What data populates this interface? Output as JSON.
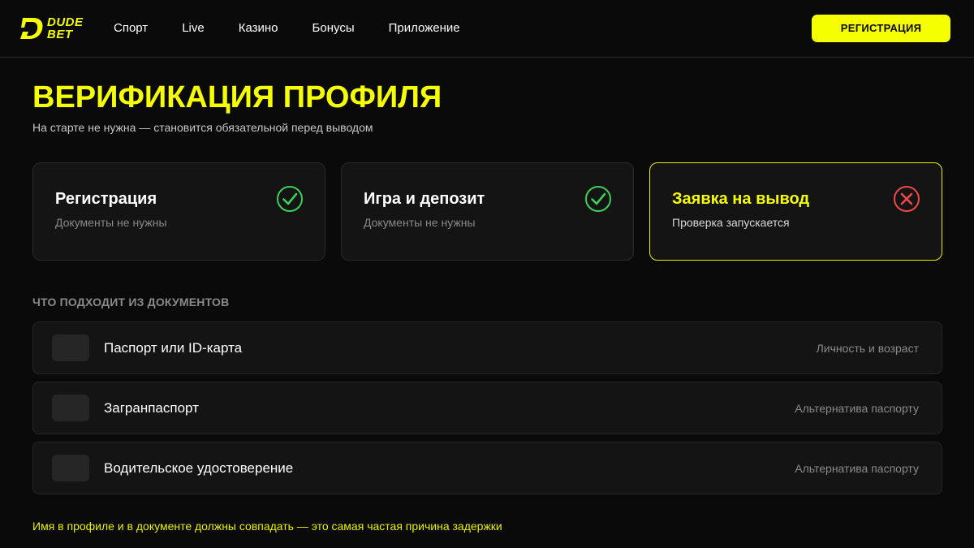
{
  "header": {
    "logo_line1": "DUDE",
    "logo_line2": "BET",
    "nav": [
      "Спорт",
      "Live",
      "Казино",
      "Бонусы",
      "Приложение"
    ],
    "register_label": "РЕГИСТРАЦИЯ"
  },
  "page": {
    "title": "ВЕРИФИКАЦИЯ ПРОФИЛЯ",
    "subtitle": "На старте не нужна — становится обязательной перед выводом"
  },
  "steps": [
    {
      "title": "Регистрация",
      "desc": "Документы не нужны",
      "status": "done",
      "icon": "check-circle-icon"
    },
    {
      "title": "Игра и депозит",
      "desc": "Документы не нужны",
      "status": "done",
      "icon": "check-circle-icon"
    },
    {
      "title": "Заявка на вывод",
      "desc": "Проверка запускается",
      "status": "required",
      "icon": "x-circle-icon"
    }
  ],
  "documents": {
    "label": "ЧТО ПОДХОДИТ ИЗ ДОКУМЕНТОВ",
    "items": [
      {
        "name": "Паспорт или ID-карта",
        "note": "Личность и возраст"
      },
      {
        "name": "Загранпаспорт",
        "note": "Альтернатива паспорту"
      },
      {
        "name": "Водительское удостоверение",
        "note": "Альтернатива паспорту"
      }
    ]
  },
  "footer_note": "Имя в профиле и в документе должны совпадать — это самая частая причина задержки",
  "colors": {
    "accent": "#f5ff00",
    "success": "#3ecf5a",
    "error": "#f04848",
    "background": "#0a0a0a",
    "card": "#141414"
  }
}
